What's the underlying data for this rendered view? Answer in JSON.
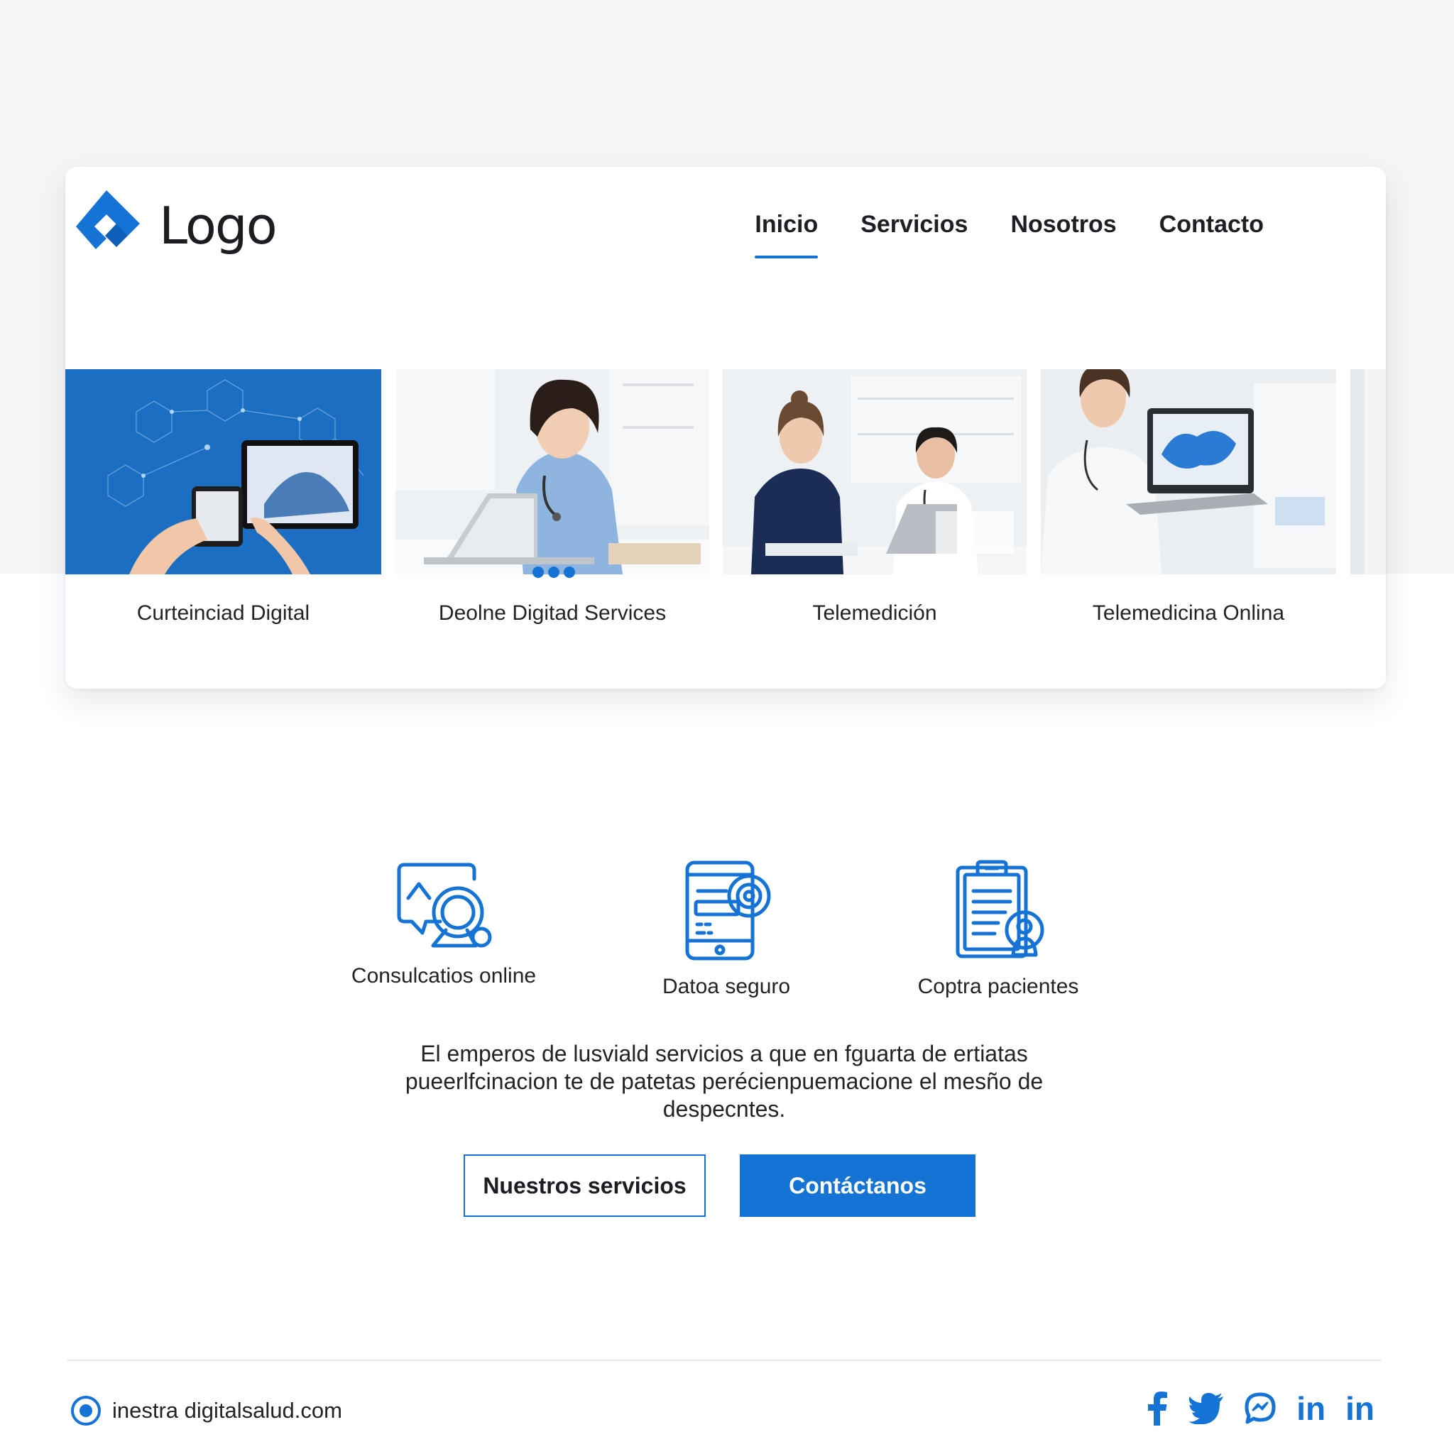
{
  "colors": {
    "accent": "#1473d4",
    "text": "#1c1f24",
    "background": "#f4f5f6"
  },
  "header": {
    "logo_text": "Logo",
    "nav": [
      {
        "label": "Inicio",
        "active": true
      },
      {
        "label": "Servicios",
        "active": false
      },
      {
        "label": "Nosotros",
        "active": false
      },
      {
        "label": "Contacto",
        "active": false
      }
    ]
  },
  "carousel": {
    "slides": [
      {
        "caption": "Curteinciad Digital",
        "icon": "tablet-network-photo"
      },
      {
        "caption": "Deolne Digitad Services",
        "icon": "doctor-laptop-photo"
      },
      {
        "caption": "Telemedición",
        "icon": "medical-team-photo"
      },
      {
        "caption": "Telemedicina Onlina",
        "icon": "doctor-laptop-scan-photo"
      }
    ],
    "dots": 3
  },
  "features": [
    {
      "label": "Consulcatios online",
      "icon": "chat-consult-icon"
    },
    {
      "label": "Datoa seguro",
      "icon": "phone-secure-icon"
    },
    {
      "label": "Coptra pacientes",
      "icon": "clipboard-patient-icon"
    }
  ],
  "description": "El emperos de lusviald servicios a que en fguarta de ertiatas pueerlfcinacion te de patetas perécienpuemacione el mesño de despecntes.",
  "buttons": {
    "secondary": "Nuestros servicios",
    "primary": "Contáctanos"
  },
  "footer": {
    "site": "inestra digitalsalud.com",
    "social": [
      "facebook",
      "twitter",
      "messenger",
      "linkedin",
      "linkedin"
    ],
    "social_labels": {
      "linkedin": "in"
    }
  }
}
